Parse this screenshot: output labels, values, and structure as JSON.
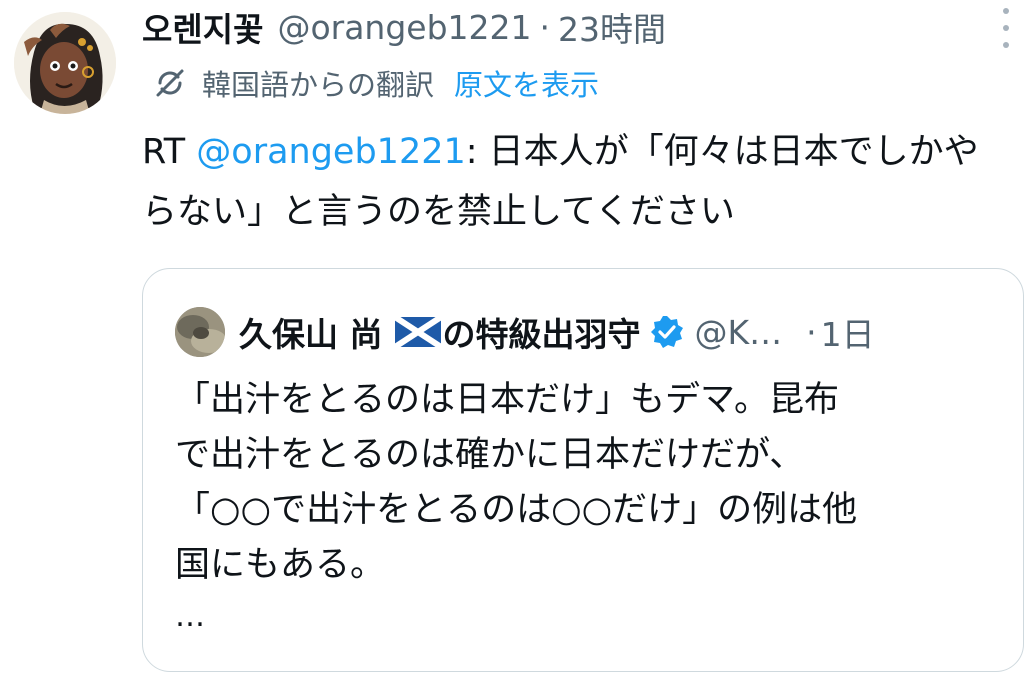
{
  "author": {
    "name": "오렌지꽃",
    "handle": "@orangeb1221",
    "separator": "·",
    "time": "23時間"
  },
  "translation": {
    "label": "韓国語からの翻訳",
    "show_original": "原文を表示"
  },
  "tweet": {
    "prefix": "RT ",
    "mention": "@orangeb1221",
    "text": ": 日本人が「何々は日本でしかやらない」と言うのを禁止してください"
  },
  "quote": {
    "name": "久保山 尚",
    "flag": "scotland-flag",
    "name_suffix": "の特級出羽守",
    "handle": "@K…",
    "separator": "·",
    "time": "1日",
    "lines": [
      "「出汁をとるのは日本だけ」もデマ。昆布",
      "で出汁をとるのは確かに日本だけだが、",
      "「○○で出汁をとるのは○○だけ」の例は他",
      "国にもある。"
    ],
    "ellipsis": "…"
  },
  "colors": {
    "text": "#0f1419",
    "secondary": "#536471",
    "link": "#1d9bf0",
    "border": "#cfd9de"
  },
  "icons": [
    "more-icon",
    "translate-icon",
    "verified-badge-icon",
    "scotland-flag-icon"
  ]
}
